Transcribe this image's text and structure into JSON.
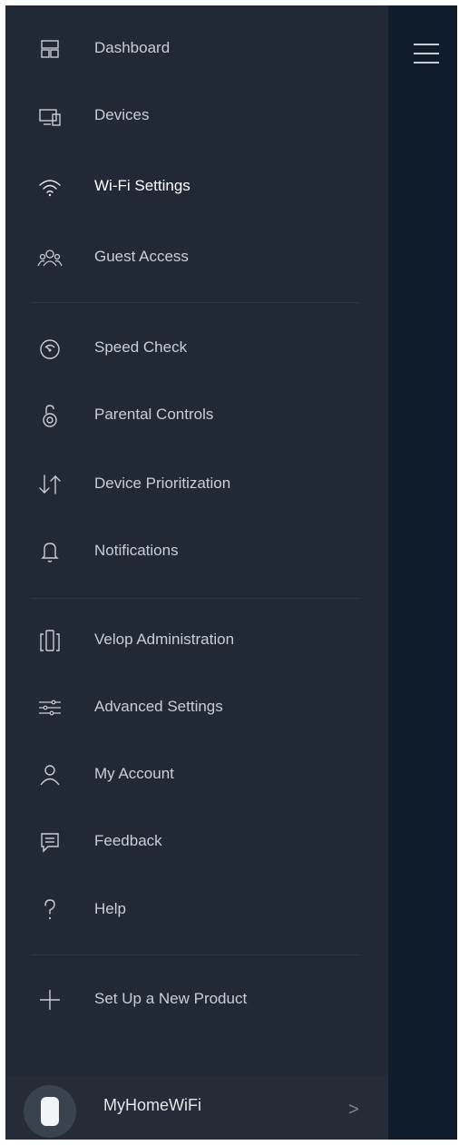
{
  "menu": {
    "items": [
      {
        "label": "Dashboard",
        "icon": "dashboard-icon"
      },
      {
        "label": "Devices",
        "icon": "devices-icon"
      },
      {
        "label": "Wi-Fi Settings",
        "icon": "wifi-icon"
      },
      {
        "label": "Guest Access",
        "icon": "guest-access-icon"
      },
      {
        "label": "Speed Check",
        "icon": "speedometer-icon"
      },
      {
        "label": "Parental Controls",
        "icon": "lock-icon"
      },
      {
        "label": "Device Prioritization",
        "icon": "priority-arrows-icon"
      },
      {
        "label": "Notifications",
        "icon": "bell-icon"
      },
      {
        "label": "Velop Administration",
        "icon": "velop-nodes-icon"
      },
      {
        "label": "Advanced Settings",
        "icon": "sliders-icon"
      },
      {
        "label": "My Account",
        "icon": "user-icon"
      },
      {
        "label": "Feedback",
        "icon": "chat-icon"
      },
      {
        "label": "Help",
        "icon": "help-icon"
      },
      {
        "label": "Set Up a New Product",
        "icon": "plus-icon"
      }
    ]
  },
  "network": {
    "name": "MyHomeWiFi",
    "chevron": ">"
  },
  "colors": {
    "drawer_bg": "#212936",
    "right_panel": "#0f1c2b",
    "text": "#c9ced5",
    "active_text": "#ffffff"
  }
}
